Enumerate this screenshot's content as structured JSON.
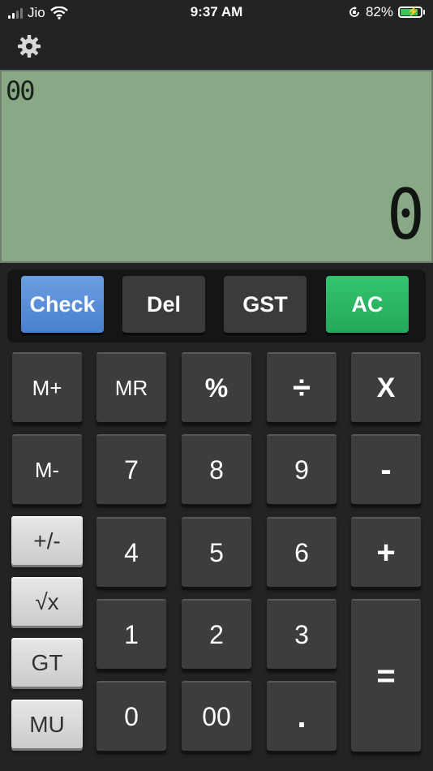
{
  "status": {
    "carrier": "Jio",
    "time": "9:37 AM",
    "battery": "82%",
    "battery_level": 0.82
  },
  "toolbar": {
    "settings_icon": "gear-icon"
  },
  "display": {
    "memory": "00",
    "value": "0"
  },
  "function_row": {
    "check": "Check",
    "del": "Del",
    "gst": "GST",
    "ac": "AC",
    "colors": {
      "check": "#5a90d8",
      "ac": "#2bb864",
      "lcd": "#88a886"
    }
  },
  "keys": {
    "m_plus": "M+",
    "mr": "MR",
    "percent": "%",
    "divide": "÷",
    "multiply": "X",
    "m_minus": "M-",
    "seven": "7",
    "eight": "8",
    "nine": "9",
    "minus": "-",
    "plus_minus": "+/-",
    "four": "4",
    "five": "5",
    "six": "6",
    "plus": "+",
    "sqrt": "√x",
    "one": "1",
    "two": "2",
    "three": "3",
    "equals": "=",
    "gt": "GT",
    "mu": "MU",
    "zero": "0",
    "double_zero": "00",
    "dot": "."
  }
}
